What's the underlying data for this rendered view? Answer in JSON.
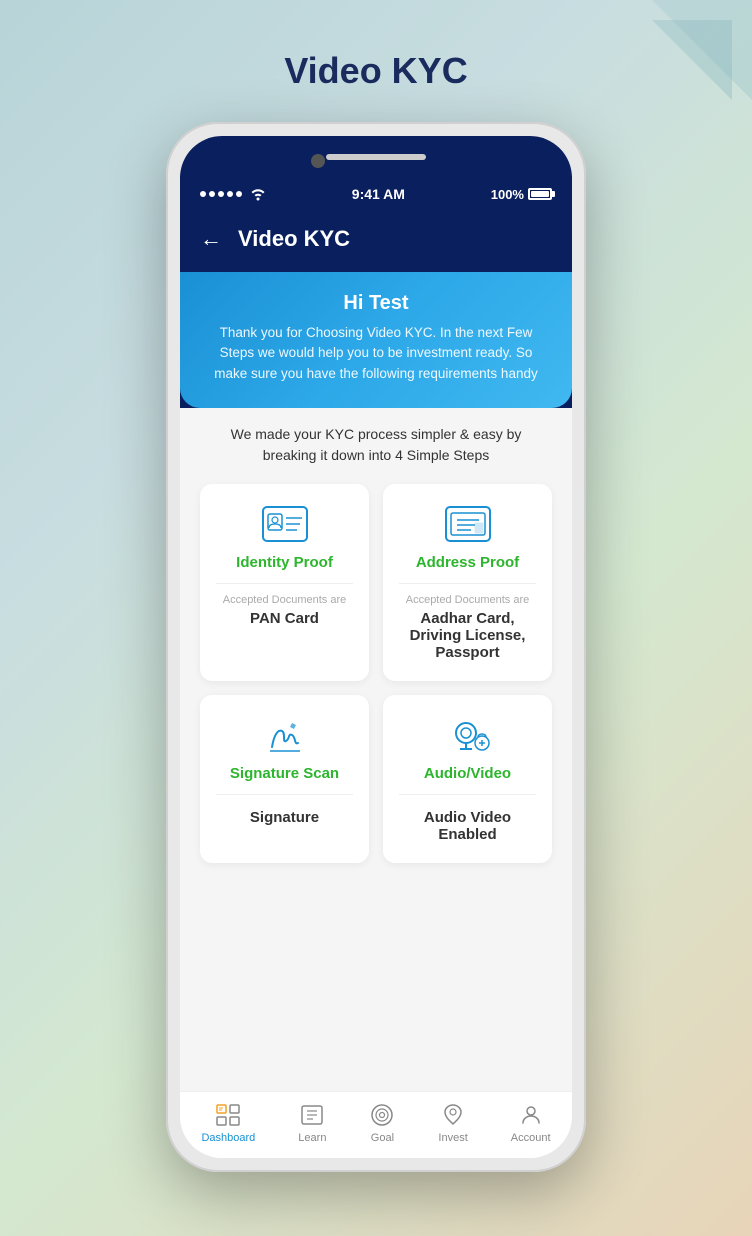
{
  "page": {
    "title": "Video KYC"
  },
  "status_bar": {
    "signal": "•••••",
    "time": "9:41 AM",
    "battery": "100%"
  },
  "app_header": {
    "back_label": "←",
    "title": "Video KYC"
  },
  "welcome_banner": {
    "greeting": "Hi Test",
    "description": "Thank you for Choosing Video KYC. In the next Few Steps we would help you to be investment ready. So make sure you have the following requirements handy"
  },
  "steps_description": "We made your KYC process simpler & easy by breaking it down into 4 Simple Steps",
  "cards": [
    {
      "id": "identity",
      "title": "Identity Proof",
      "accepted_label": "Accepted Documents are",
      "doc_name": "PAN Card"
    },
    {
      "id": "address",
      "title": "Address Proof",
      "accepted_label": "Accepted Documents are",
      "doc_name": "Aadhar Card, Driving License, Passport"
    },
    {
      "id": "signature",
      "title": "Signature Scan",
      "accepted_label": "",
      "doc_name": "Signature"
    },
    {
      "id": "audio",
      "title": "Audio/Video",
      "accepted_label": "",
      "doc_name": "Audio Video Enabled"
    }
  ],
  "bottom_nav": [
    {
      "id": "dashboard",
      "label": "Dashboard",
      "active": true
    },
    {
      "id": "learn",
      "label": "Learn",
      "active": false
    },
    {
      "id": "goal",
      "label": "Goal",
      "active": false
    },
    {
      "id": "invest",
      "label": "Invest",
      "active": false
    },
    {
      "id": "account",
      "label": "Account",
      "active": false
    }
  ]
}
